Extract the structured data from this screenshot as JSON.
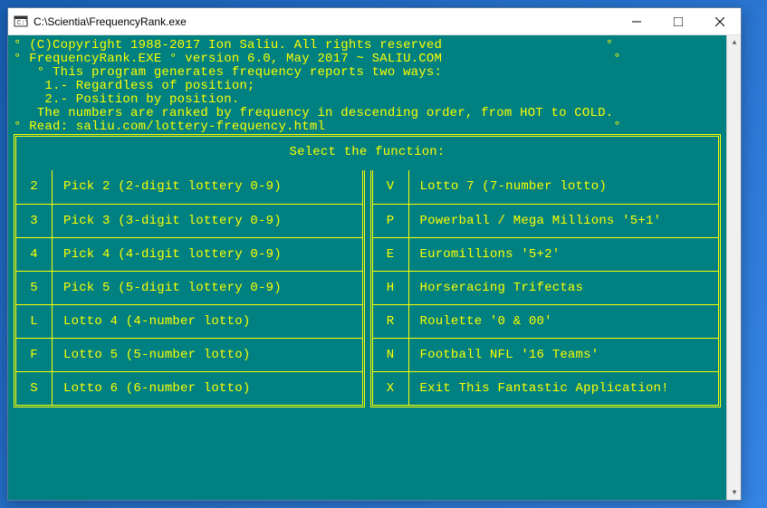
{
  "window": {
    "title": "C:\\Scientia\\FrequencyRank.exe"
  },
  "header": {
    "line1": "° (C)Copyright 1988-2017 Ion Saliu. All rights reserved                     °",
    "line2": "° FrequencyRank.EXE ° version 6.0, May 2017 ~ SALIU.COM                      °",
    "line3": "   ° This program generates frequency reports two ways:",
    "line4": "    1.- Regardless of position;",
    "line5": "    2.- Position by position.",
    "line6": "   The numbers are ranked by frequency in descending order, from HOT to COLD.",
    "line7": "° Read: saliu.com/lottery-frequency.html                                     °"
  },
  "menu": {
    "title": "Select the function:",
    "left": [
      {
        "key": "2",
        "desc": "Pick 2 (2-digit lottery 0-9)"
      },
      {
        "key": "3",
        "desc": "Pick 3 (3-digit lottery 0-9)"
      },
      {
        "key": "4",
        "desc": "Pick 4 (4-digit lottery 0-9)"
      },
      {
        "key": "5",
        "desc": "Pick 5 (5-digit lottery 0-9)"
      },
      {
        "key": "L",
        "desc": "Lotto 4 (4-number lotto)"
      },
      {
        "key": "F",
        "desc": "Lotto 5 (5-number lotto)"
      },
      {
        "key": "S",
        "desc": "Lotto 6 (6-number lotto)"
      }
    ],
    "right": [
      {
        "key": "V",
        "desc": "Lotto 7 (7-number lotto)"
      },
      {
        "key": "P",
        "desc": "Powerball / Mega Millions '5+1'"
      },
      {
        "key": "E",
        "desc": "Euromillions '5+2'"
      },
      {
        "key": "H",
        "desc": "Horseracing Trifectas"
      },
      {
        "key": "R",
        "desc": "Roulette '0 & 00'"
      },
      {
        "key": "N",
        "desc": "Football NFL '16 Teams'"
      },
      {
        "key": "X",
        "desc": "Exit This Fantastic Application!"
      }
    ]
  }
}
